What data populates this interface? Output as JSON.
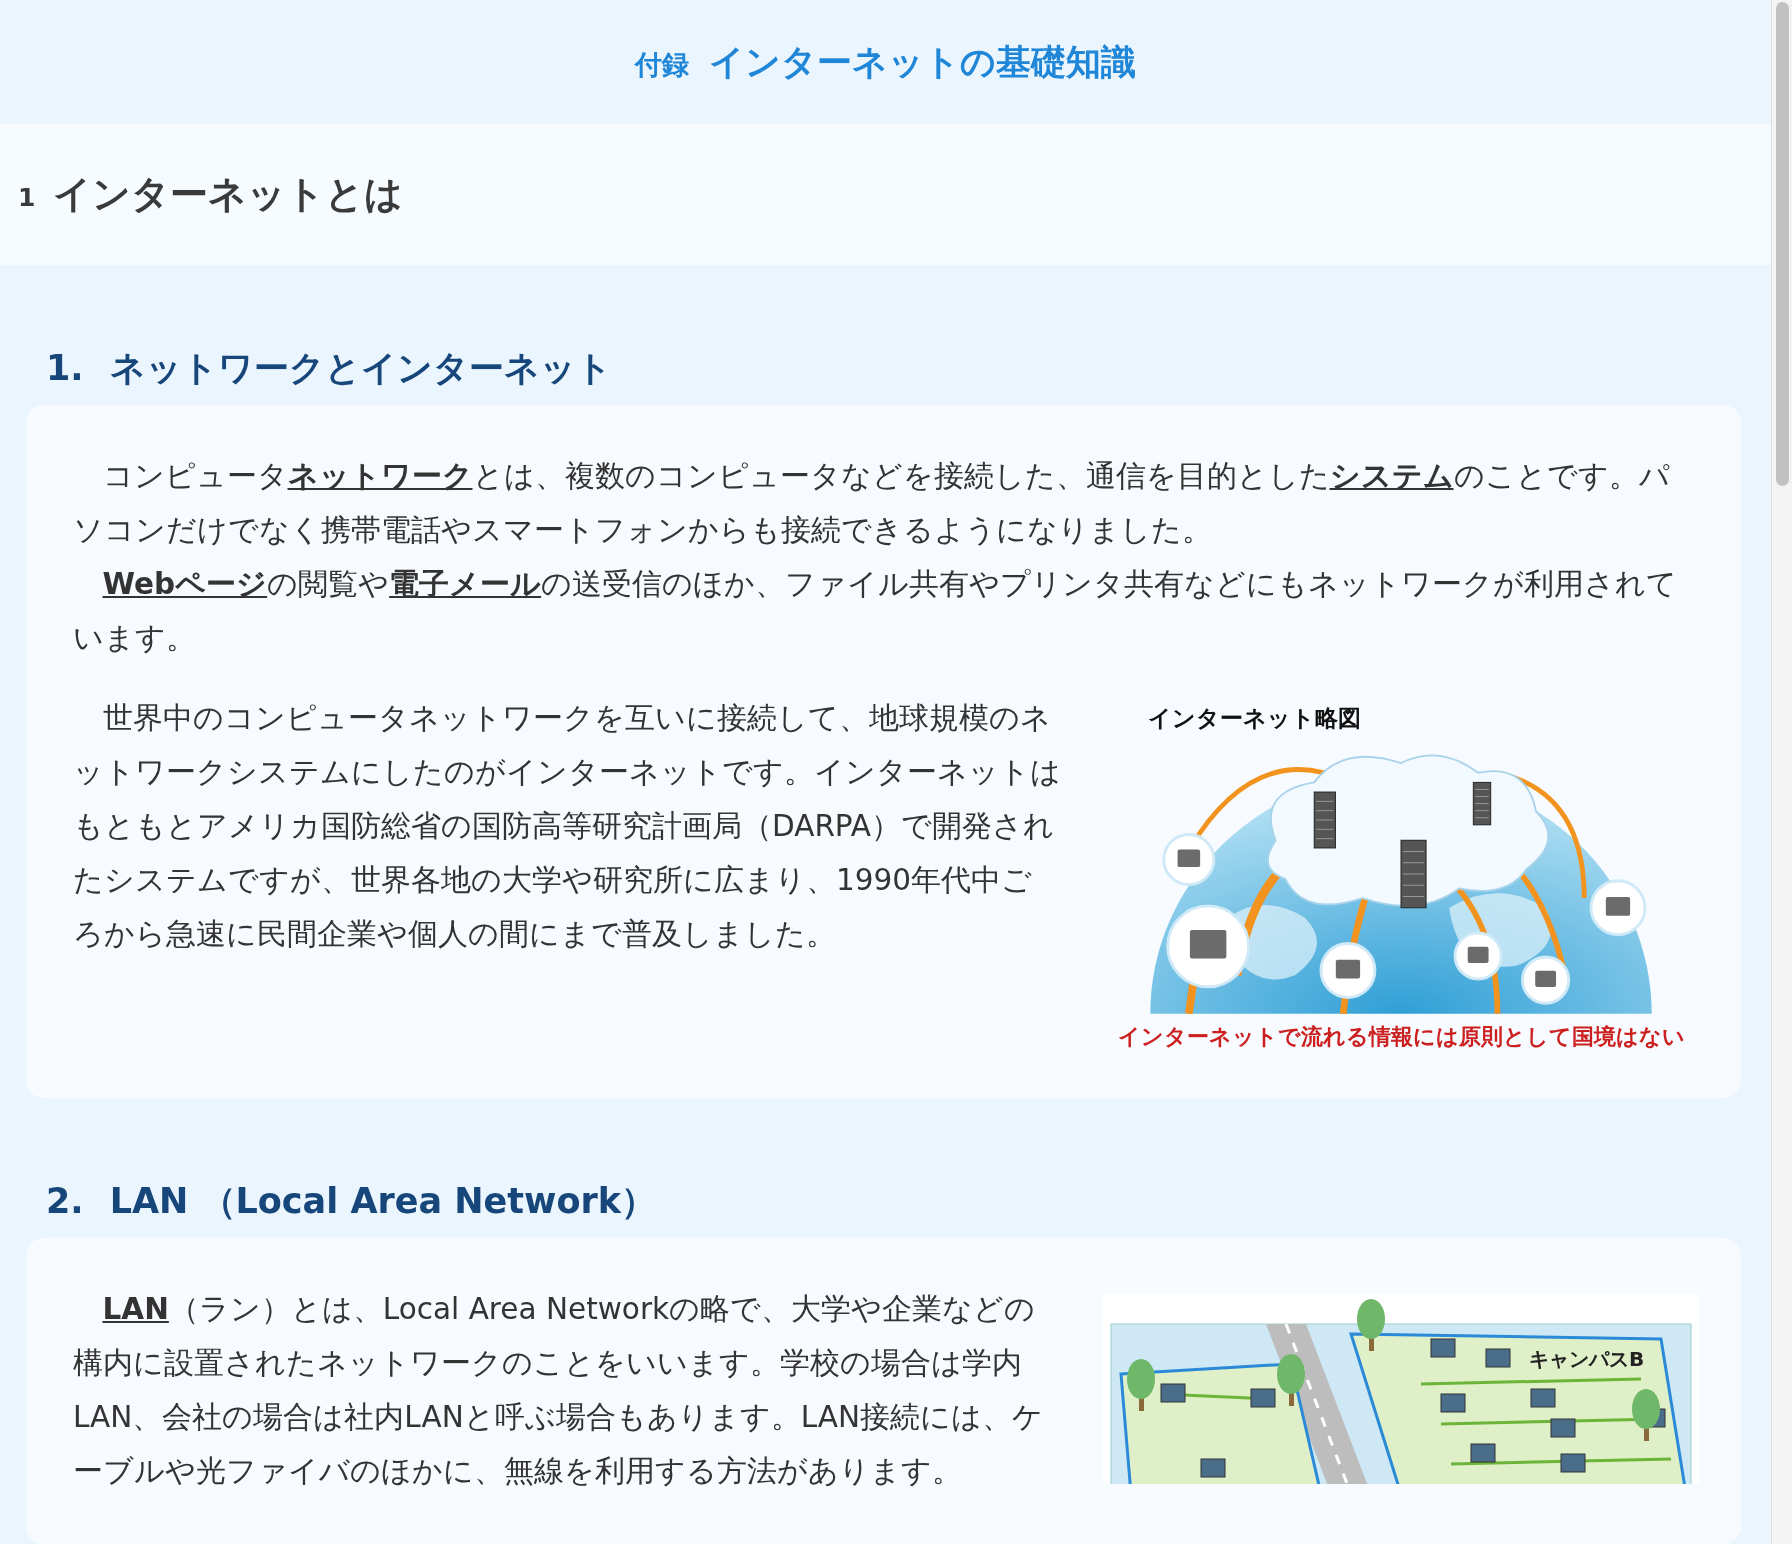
{
  "header": {
    "prefix": "付録",
    "title": "インターネットの基礎知識"
  },
  "chapter": {
    "number": "1",
    "title": "インターネットとは"
  },
  "sections": [
    {
      "number": "1.",
      "title": "ネットワークとインターネット",
      "blocks": [
        {
          "kind": "text",
          "paragraphs": [
            [
              {
                "text": "コンピュータ",
                "link": false
              },
              {
                "text": "ネットワーク",
                "link": true
              },
              {
                "text": "とは、複数のコンピュータなどを接続した、通信を目的とした",
                "link": false
              },
              {
                "text": "システム",
                "link": true
              },
              {
                "text": "のことです。パソコンだけでなく携帯電話やスマートフォンからも接続できるようになりました。",
                "link": false
              }
            ],
            [
              {
                "text": "Webページ",
                "link": true
              },
              {
                "text": "の閲覧や",
                "link": false
              },
              {
                "text": "電子メール",
                "link": true
              },
              {
                "text": "の送受信のほか、ファイル共有やプリンタ共有などにもネットワークが利用されています。",
                "link": false
              }
            ]
          ]
        },
        {
          "kind": "figure_row",
          "paragraphs": [
            [
              {
                "text": "世界中のコンピュータネットワークを互いに接続して、地球規模のネットワークシステムにしたのがインターネットです。インターネットはもともとアメリカ国防総省の国防高等研究計画局（DARPA）で開発されたシステムですが、世界各地の大学や研究所に広まり、1990年代中ごろから急速に民間企業や個人の間にまで普及しました。",
                "link": false
              }
            ]
          ],
          "figure": {
            "kind": "internet",
            "title": "インターネット略図",
            "caption": "インターネットで流れる情報には原則として国境はない"
          }
        }
      ]
    },
    {
      "number": "2.",
      "title": "LAN （Local Area Network）",
      "blocks": [
        {
          "kind": "figure_row",
          "paragraphs": [
            [
              {
                "text": "LAN",
                "link": true
              },
              {
                "text": "（ラン）とは、Local Area Networkの略で、大学や企業などの構内に設置されたネットワークのことをいいます。学校の場合は学内LAN、会社の場合は社内LANと呼ぶ場合もあります。LAN接続には、ケーブルや光ファイバのほかに、無線を利用する方法があります。",
                "link": false
              }
            ]
          ],
          "figure": {
            "kind": "campus",
            "label": "キャンパスB"
          }
        }
      ]
    }
  ]
}
